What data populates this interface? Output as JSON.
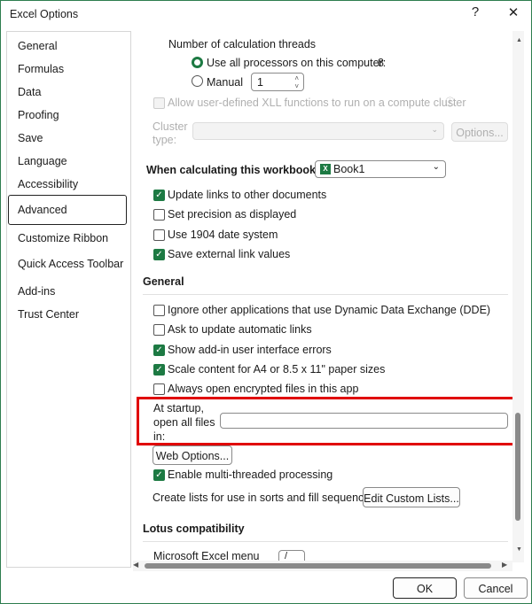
{
  "window": {
    "title": "Excel Options",
    "help": "?",
    "close": "✕"
  },
  "sidebar": {
    "items": [
      "General",
      "Formulas",
      "Data",
      "Proofing",
      "Save",
      "Language",
      "Accessibility",
      "Advanced",
      "Customize Ribbon",
      "Quick Access Toolbar",
      "Add-ins",
      "Trust Center"
    ],
    "selected": "Advanced"
  },
  "calc": {
    "threads_label": "Number of calculation threads",
    "use_all_label": "Use all processors on this computer:",
    "processors": "8",
    "manual_label": "Manual",
    "manual_value": "1",
    "xll_label": "Allow user-defined XLL functions to run on a compute cluster",
    "cluster_label_1": "Cluster",
    "cluster_label_2": "type:",
    "options_btn": "Options..."
  },
  "workbook": {
    "label": "When calculating this workbook:",
    "value": "Book1",
    "options": [
      {
        "label": "Update links to other documents",
        "checked": true
      },
      {
        "label": "Set precision as displayed",
        "checked": false
      },
      {
        "label": "Use 1904 date system",
        "checked": false
      },
      {
        "label": "Save external link values",
        "checked": true
      }
    ]
  },
  "general": {
    "heading": "General",
    "options": [
      {
        "label": "Ignore other applications that use Dynamic Data Exchange (DDE)",
        "checked": false
      },
      {
        "label": "Ask to update automatic links",
        "checked": false
      },
      {
        "label": "Show add-in user interface errors",
        "checked": true
      },
      {
        "label": "Scale content for A4 or 8.5 x 11\" paper sizes",
        "checked": true
      },
      {
        "label": "Always open encrypted files in this app",
        "checked": false
      }
    ],
    "startup_1": "At startup,",
    "startup_2": "open all files",
    "startup_3": "in:",
    "startup_value": "",
    "web_options": "Web Options...",
    "multithread_label": "Enable multi-threaded processing",
    "multithread_checked": true,
    "lists_label": "Create lists for use in sorts and fill sequences:",
    "edit_lists": "Edit Custom Lists..."
  },
  "lotus": {
    "heading": "Lotus compatibility",
    "menu_key_label": "Microsoft Excel menu key:",
    "menu_key_value": "/"
  },
  "footer": {
    "ok": "OK",
    "cancel": "Cancel"
  },
  "colors": {
    "accent": "#1d7a43",
    "highlight": "#e00000"
  }
}
